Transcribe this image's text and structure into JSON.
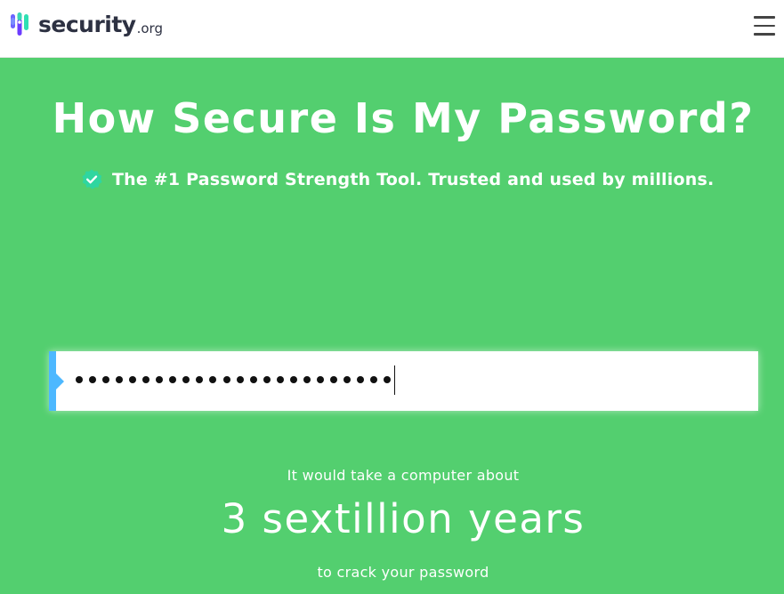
{
  "header": {
    "logo_word": "security",
    "logo_tld": ".org",
    "logo_icon": "security-org-bars-logo",
    "menu_icon": "hamburger-menu-icon"
  },
  "hero": {
    "title": "How Secure Is My Password?",
    "subtitle": "The #1 Password Strength Tool. Trusted and used by millions.",
    "subtitle_icon": "verified-check-badge-icon"
  },
  "password_field": {
    "masked_length": 24,
    "type": "password"
  },
  "result": {
    "pre_text": "It would take a computer about",
    "time_text": "3 sextillion years",
    "post_text": "to crack your password"
  },
  "colors": {
    "background": "#53cf6f",
    "header_bg": "#ffffff",
    "accent_blue": "#4db8ff",
    "logo_text": "#2d3142",
    "check_badge": "#2fd6a0"
  }
}
